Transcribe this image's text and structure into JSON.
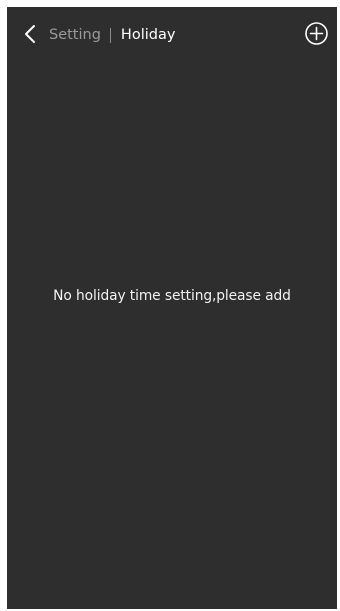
{
  "header": {
    "back_icon": "chevron-left-icon",
    "parent_label": "Setting",
    "title": "Holiday",
    "add_icon": "plus-circle-icon"
  },
  "main": {
    "empty_message": "No holiday time setting,please add"
  },
  "colors": {
    "background": "#2e2e2e",
    "text_primary": "#ffffff",
    "text_muted": "#9a9a9a"
  }
}
